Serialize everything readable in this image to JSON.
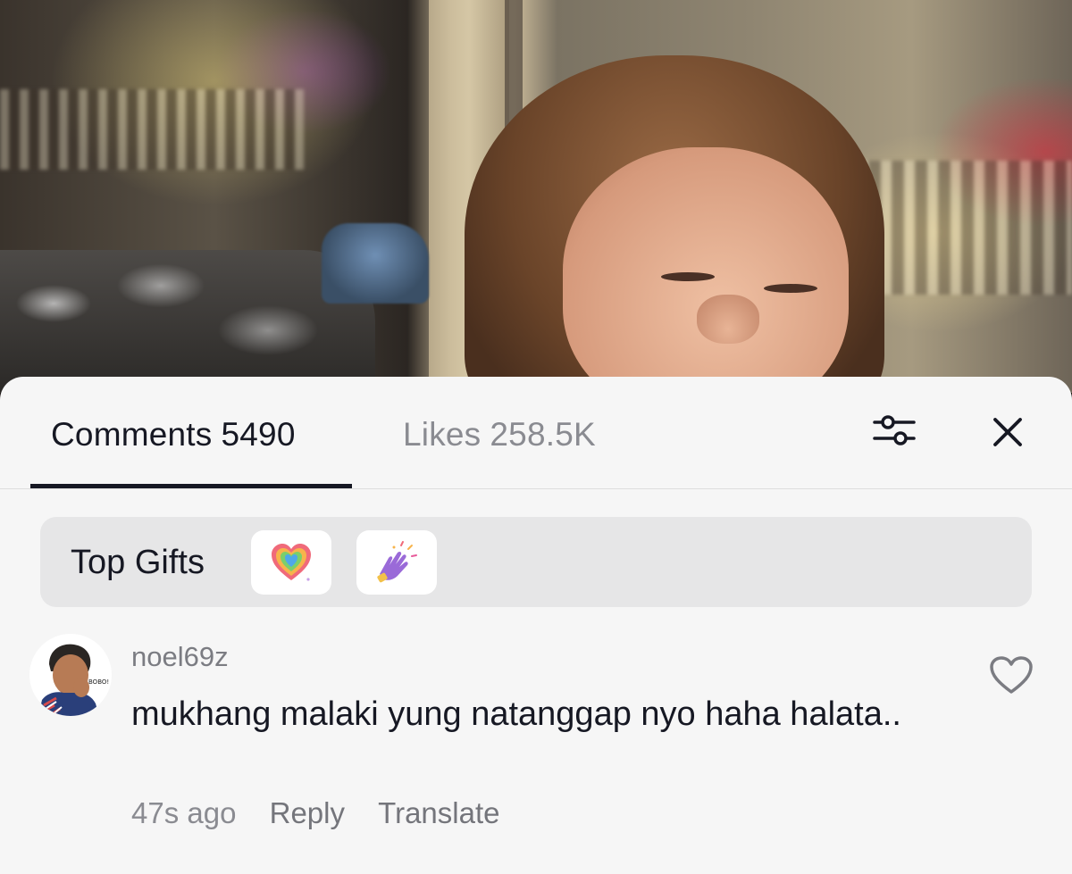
{
  "video": {
    "description_icon": "video-frame"
  },
  "panel": {
    "tabs": [
      {
        "label": "Comments",
        "count": "5490",
        "active": true
      },
      {
        "label": "Likes",
        "count": "258.5K",
        "active": false
      }
    ],
    "filter_icon": "sliders-icon",
    "close_icon": "close-icon"
  },
  "top_gifts": {
    "label": "Top Gifts",
    "gifts": [
      {
        "icon": "rainbow-heart-icon"
      },
      {
        "icon": "clapping-hands-icon"
      }
    ]
  },
  "comment": {
    "username": "noel69z",
    "text": "mukhang malaki yung natanggap nyo haha halata..",
    "time": "47s ago",
    "reply_label": "Reply",
    "translate_label": "Translate",
    "like_icon": "heart-outline-icon"
  },
  "colors": {
    "text_primary": "#161823",
    "text_secondary": "#8a8b91",
    "sheet_bg": "#f6f6f6",
    "gifts_bg": "#e6e6e7"
  }
}
